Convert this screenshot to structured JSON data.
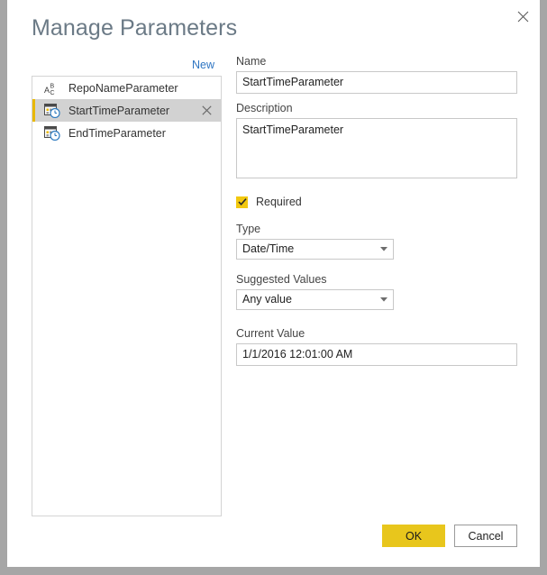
{
  "dialog": {
    "title": "Manage Parameters",
    "close_icon": "close-icon"
  },
  "left_panel": {
    "new_label": "New",
    "parameters": [
      {
        "name": "RepoNameParameter",
        "icon": "abc-text-icon",
        "selected": false,
        "deletable": false
      },
      {
        "name": "StartTimeParameter",
        "icon": "calendar-clock-icon",
        "selected": true,
        "deletable": true
      },
      {
        "name": "EndTimeParameter",
        "icon": "calendar-clock-icon",
        "selected": false,
        "deletable": false
      }
    ]
  },
  "form": {
    "name_label": "Name",
    "name_value": "StartTimeParameter",
    "name_placeholder": "",
    "description_label": "Description",
    "description_value": "StartTimeParameter",
    "description_placeholder": "",
    "required_label": "Required",
    "required_checked": true,
    "type_label": "Type",
    "type_value": "Date/Time",
    "suggested_values_label": "Suggested Values",
    "suggested_values_value": "Any value",
    "current_value_label": "Current Value",
    "current_value_value": "1/1/2016 12:01:00 AM"
  },
  "footer": {
    "ok_label": "OK",
    "cancel_label": "Cancel"
  },
  "colors": {
    "accent_yellow": "#f2c80f",
    "ok_button": "#e8c61c",
    "link_blue": "#2e75c2",
    "selected_row": "#d2d2d2",
    "window_surround": "#a6a6a6"
  }
}
